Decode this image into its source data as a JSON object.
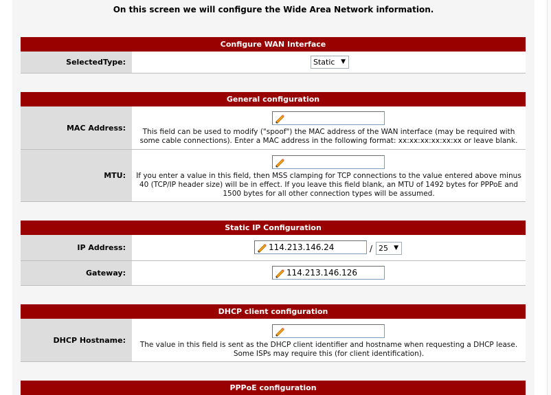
{
  "intro": "On this screen we will configure the Wide Area Network information.",
  "wan_interface": {
    "header": "Configure WAN Interface",
    "selected_type_label": "SelectedType:",
    "selected_type_value": "Static"
  },
  "general": {
    "header": "General configuration",
    "mac_label": "MAC Address:",
    "mac_value": "",
    "mac_note": "This field can be used to modify (\"spoof\") the MAC address of the WAN interface (may be required with some cable connections). Enter a MAC address in the following format: xx:xx:xx:xx:xx:xx or leave blank.",
    "mtu_label": "MTU:",
    "mtu_value": "",
    "mtu_note": "If you enter a value in this field, then MSS clamping for TCP connections to the value entered above minus 40 (TCP/IP header size) will be in effect. If you leave this field blank, an MTU of 1492 bytes for PPPoE and 1500 bytes for all other connection types will be assumed."
  },
  "static_ip": {
    "header": "Static IP Configuration",
    "ip_label": "IP Address:",
    "ip_value": "114.213.146.24",
    "ip_separator": "/",
    "subnet_value": "25",
    "gateway_label": "Gateway:",
    "gateway_value": "114.213.146.126"
  },
  "dhcp": {
    "header": "DHCP client configuration",
    "hostname_label": "DHCP Hostname:",
    "hostname_value": "",
    "hostname_note": "The value in this field is sent as the DHCP client identifier and hostname when requesting a DHCP lease. Some ISPs may require this (for client identification)."
  },
  "pppoe": {
    "header": "PPPoE configuration"
  },
  "icons": {
    "field_icon": "pencil-icon",
    "dropdown_icon": "chevron-down-icon"
  },
  "colors": {
    "header_bg": "#990000",
    "label_bg": "#dddddd"
  }
}
